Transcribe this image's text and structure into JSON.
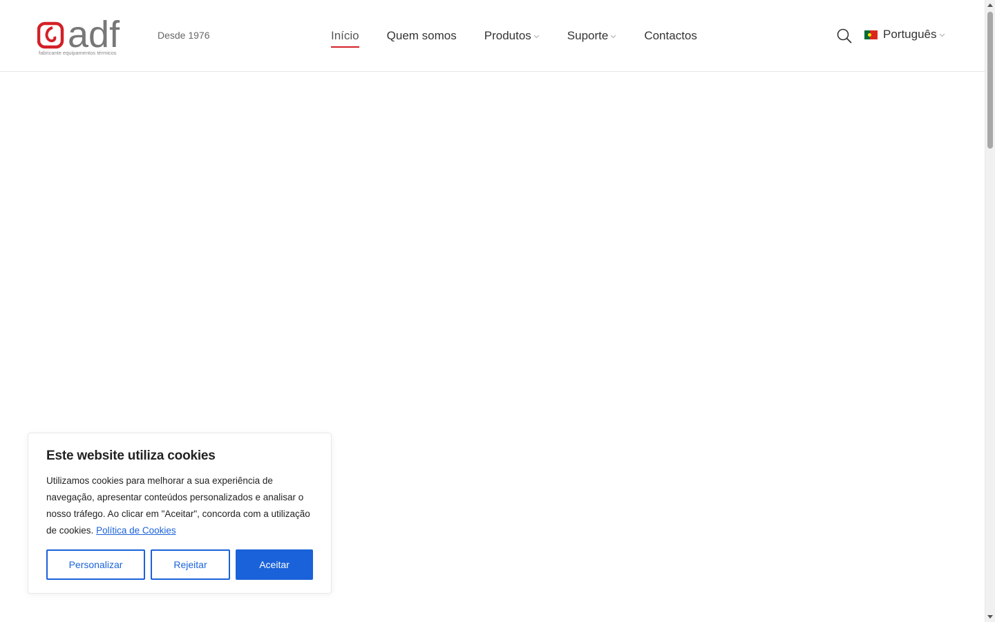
{
  "header": {
    "logo_text": "adf",
    "logo_tagline": "fabricante equipamentos térmicos",
    "since": "Desde 1976",
    "nav": [
      {
        "label": "Início"
      },
      {
        "label": "Quem somos"
      },
      {
        "label": "Produtos"
      },
      {
        "label": "Suporte"
      },
      {
        "label": "Contactos"
      }
    ],
    "language": "Português"
  },
  "cookie_banner": {
    "title": "Este website utiliza cookies",
    "text": "Utilizamos cookies para melhorar a sua experiência de navegação, apresentar conteúdos personalizados e analisar o nosso tráfego. Ao clicar em \"Aceitar\", concorda com a utilização de cookies.",
    "policy_link": "Política de Cookies",
    "buttons": {
      "customize": "Personalizar",
      "reject": "Rejeitar",
      "accept": "Aceitar"
    }
  },
  "colors": {
    "brand_red": "#d32027",
    "logo_gray": "#777777",
    "accent_blue": "#1a62d9"
  }
}
